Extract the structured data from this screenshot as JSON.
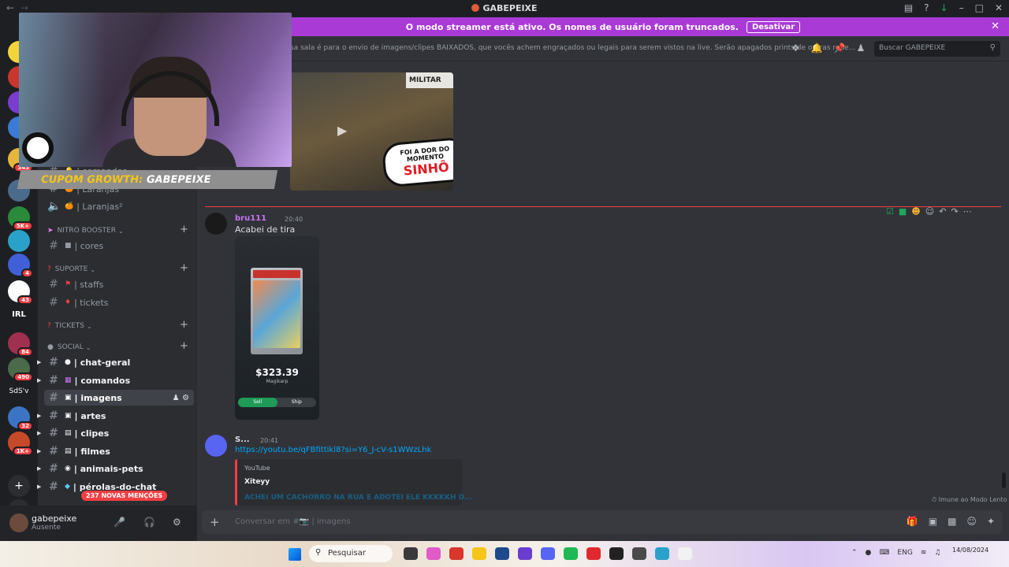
{
  "window": {
    "title": "GABEPEIXE"
  },
  "banner": {
    "text": "O modo streamer está ativo. Os nomes de usuário foram truncados.",
    "button": "Desativar"
  },
  "rail": {
    "badges": [
      "343",
      "4",
      "84",
      "490",
      "32",
      "1K+",
      "5K+",
      "43"
    ],
    "labels": [
      "IRL",
      "SdS'v"
    ]
  },
  "sidebar": {
    "channels_top": [
      {
        "name": "| comandos"
      },
      {
        "name": "| Laranjas"
      },
      {
        "name": "| Laranjas²"
      }
    ],
    "categories": {
      "nitro": "NITRO BOOSTER",
      "suporte": "SUPORTE",
      "tickets": "TICKETS",
      "social": "SOCIAL"
    },
    "channels": {
      "cores": "| cores",
      "staffs": "| staffs",
      "tickets": "| tickets",
      "chat_geral": "| chat-geral",
      "comandos": "| comandos",
      "imagens": "| imagens",
      "artes": "| artes",
      "clipes": "| clipes",
      "filmes": "| filmes",
      "animais": "| animais-pets",
      "perolas": "| pérolas-do-chat"
    },
    "mentions_pill": "237 NOVAS MENÇÕES"
  },
  "user": {
    "name": "gabepeixe",
    "status": "Ausente"
  },
  "header": {
    "topic": "sa sala é para o envio de imagens/clipes BAIXADOS, que vocês achem engraçados ou legais para serem vistos na live. Serão apagados prints de outras rede...",
    "search_placeholder": "Buscar GABEPEIXE"
  },
  "messages": {
    "thumb_caption_small": "FOI A DOR DO MOMENTO",
    "thumb_caption_big": "SINHÔ",
    "thumb_banner": "MILITAR",
    "m1": {
      "author": "bru111",
      "time": "20:40",
      "text": "Acabei de tira",
      "author_color": "#c774f5"
    },
    "card": {
      "price": "$323.39",
      "subtitle": "Magikarp",
      "sell": "Sell",
      "ship": "Ship"
    },
    "m2": {
      "author": "S...",
      "time": "20:41",
      "link": "https://youtu.be/qFBfittikl8?si=Y6_J-cV-s1WWzLhk"
    },
    "embed": {
      "provider": "YouTube",
      "channel": "Xiteyy",
      "video_title": "ACHEI UM CACHORRO NA RUA E ADOTEI ELE KKKKKH D..."
    },
    "slowmode": "Imune ao Modo Lento"
  },
  "composer": {
    "placeholder": "Conversar em #📷 | imagens"
  },
  "coupon": {
    "label": "CUPOM GROWTH:",
    "code": "GABEPEIXE"
  },
  "taskbar": {
    "search": "Pesquisar",
    "lang": "ENG",
    "date": "14/08/2024"
  },
  "colors": {
    "accent": "#a93ad6",
    "mention": "#f23f43",
    "link": "#00a8fc"
  }
}
